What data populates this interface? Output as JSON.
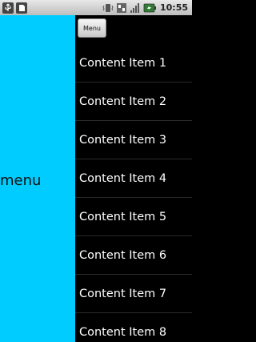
{
  "status_bar": {
    "time": "10:55",
    "icons_left": [
      "usb-icon",
      "sd-card-icon"
    ],
    "icons_right": [
      "vibrate-icon",
      "data-transfer-icon",
      "signal-icon",
      "battery-icon"
    ]
  },
  "menu_pane": {
    "label": "menu",
    "background": "#00ccff"
  },
  "content": {
    "menu_button_label": "Menu",
    "items": [
      "Content Item 1",
      "Content Item 2",
      "Content Item 3",
      "Content Item 4",
      "Content Item 5",
      "Content Item 6",
      "Content Item 7",
      "Content Item 8"
    ]
  }
}
